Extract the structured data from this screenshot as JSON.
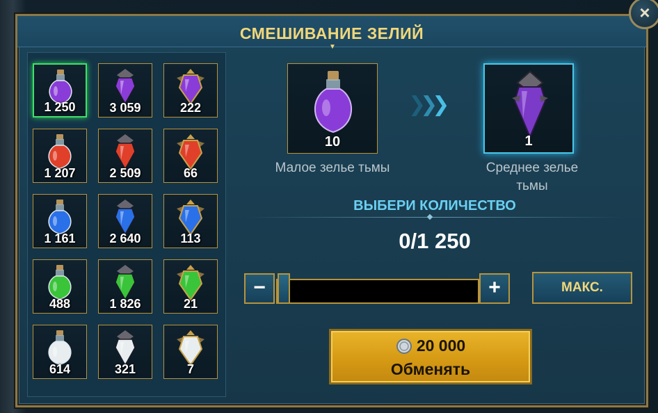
{
  "dialog": {
    "title": "СМЕШИВАНИЕ ЗЕЛИЙ",
    "close_icon": "×"
  },
  "inventory": {
    "potions": [
      {
        "name": "small-dark-potion",
        "count": "1 250",
        "color": "#8a3cd8"
      },
      {
        "name": "medium-dark-potion",
        "count": "3 059",
        "color": "#8a3cd8"
      },
      {
        "name": "large-dark-potion",
        "count": "222",
        "color": "#8a3cd8"
      },
      {
        "name": "small-fire-potion",
        "count": "1 207",
        "color": "#e0402a"
      },
      {
        "name": "medium-fire-potion",
        "count": "2 509",
        "color": "#e0402a"
      },
      {
        "name": "large-fire-potion",
        "count": "66",
        "color": "#e0402a"
      },
      {
        "name": "small-water-potion",
        "count": "1 161",
        "color": "#2a70e8"
      },
      {
        "name": "medium-water-potion",
        "count": "2 640",
        "color": "#2a70e8"
      },
      {
        "name": "large-water-potion",
        "count": "113",
        "color": "#2a70e8"
      },
      {
        "name": "small-nature-potion",
        "count": "488",
        "color": "#3ac43a"
      },
      {
        "name": "medium-nature-potion",
        "count": "1 826",
        "color": "#3ac43a"
      },
      {
        "name": "large-nature-potion",
        "count": "21",
        "color": "#3ac43a"
      },
      {
        "name": "small-light-potion",
        "count": "614",
        "color": "#e8eef0"
      },
      {
        "name": "medium-light-potion",
        "count": "321",
        "color": "#e8eef0"
      },
      {
        "name": "large-light-potion",
        "count": "7",
        "color": "#e8eef0"
      }
    ],
    "selected_index": 0
  },
  "recipe": {
    "source": {
      "label": "Малое зелье тьмы",
      "count": "10"
    },
    "target": {
      "label_line1": "Среднее зелье",
      "label_line2": "тьмы",
      "count": "1"
    }
  },
  "quantity": {
    "heading": "ВЫБЕРИ КОЛИЧЕСТВО",
    "display": "0/1 250",
    "minus": "−",
    "plus": "+",
    "max_label": "МАКС."
  },
  "exchange": {
    "cost": "20 000",
    "label": "Обменять"
  },
  "colors": {
    "accent_gold": "#f1d77a",
    "frame_gold": "#b8943c",
    "heading_blue": "#6ad0f2",
    "selected_green": "#40e06a"
  }
}
